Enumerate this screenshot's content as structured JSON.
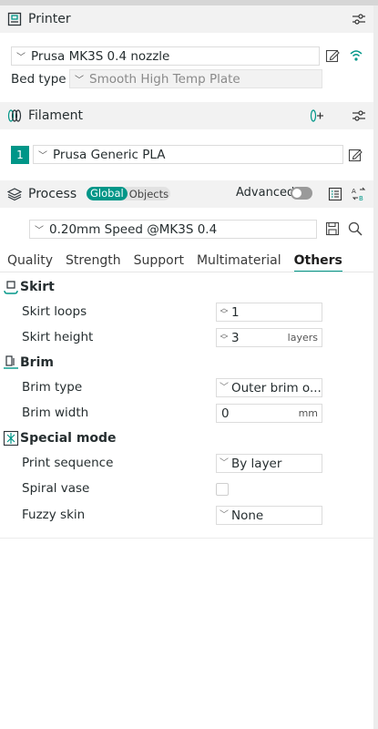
{
  "colors": {
    "accent": "#009688",
    "header_bg": "#f2f2f2"
  },
  "printer": {
    "title": "Printer",
    "preset": "Prusa MK3S 0.4 nozzle",
    "bed_type_label": "Bed type",
    "bed_type_value": "Smooth High Temp Plate"
  },
  "filament": {
    "title": "Filament",
    "slot_number": "1",
    "preset": "Prusa Generic PLA"
  },
  "process": {
    "title": "Process",
    "toggle_global": "Global",
    "toggle_objects": "Objects",
    "advanced_label": "Advanced",
    "preset": "0.20mm Speed @MK3S 0.4"
  },
  "tabs": [
    "Quality",
    "Strength",
    "Support",
    "Multimaterial",
    "Others"
  ],
  "active_tab": "Others",
  "groups": {
    "skirt": {
      "title": "Skirt",
      "loops_label": "Skirt loops",
      "loops_value": "1",
      "height_label": "Skirt height",
      "height_value": "3",
      "height_unit": "layers"
    },
    "brim": {
      "title": "Brim",
      "type_label": "Brim type",
      "type_value": "Outer brim o...",
      "width_label": "Brim width",
      "width_value": "0",
      "width_unit": "mm"
    },
    "special": {
      "title": "Special mode",
      "sequence_label": "Print sequence",
      "sequence_value": "By layer",
      "spiral_label": "Spiral vase",
      "fuzzy_label": "Fuzzy skin",
      "fuzzy_value": "None"
    }
  }
}
